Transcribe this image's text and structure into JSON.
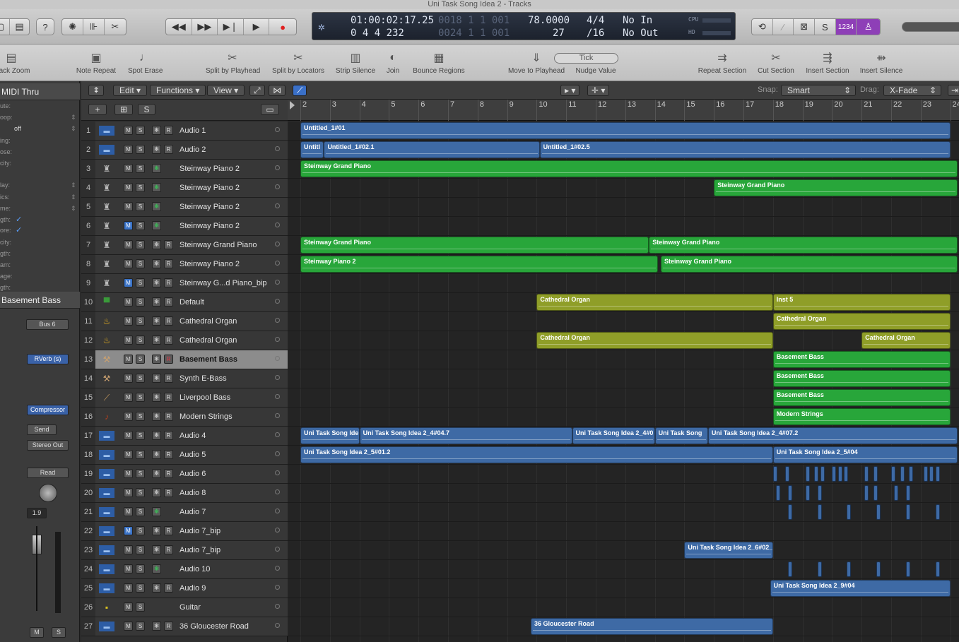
{
  "window": {
    "title": "Uni Task Song Idea 2 - Tracks"
  },
  "lcd": {
    "position_time": "01:00:02:17.25",
    "position_bars": "0  4  4  232",
    "time_dim": "0018  1  1  001",
    "bars_dim": "0024  1  1  001",
    "tempo": "78.0000",
    "sig_top": "4/4",
    "bar_num": "27",
    "division": "/16",
    "midi_in": "No In",
    "midi_out": "No Out",
    "cpu": "CPU",
    "hd": "HD"
  },
  "control": {
    "count_in": "1234"
  },
  "toolbar": {
    "items": [
      {
        "label": "Track Zoom",
        "icon": "track-zoom-icon"
      },
      {
        "label": "Note Repeat",
        "icon": "note-repeat-icon"
      },
      {
        "label": "Spot Erase",
        "icon": "spot-erase-icon"
      },
      {
        "label": "Split by Playhead",
        "icon": "scissors-icon"
      },
      {
        "label": "Split by Locators",
        "icon": "scissors-locators-icon"
      },
      {
        "label": "Strip Silence",
        "icon": "strip-silence-icon"
      },
      {
        "label": "Join",
        "icon": "glue-icon"
      },
      {
        "label": "Bounce Regions",
        "icon": "bounce-icon"
      },
      {
        "label": "Move to Playhead",
        "icon": "playhead-icon"
      },
      {
        "label": "Nudge Value",
        "icon": "nudge-icon"
      },
      {
        "label": "Repeat Section",
        "icon": "repeat-section-icon"
      },
      {
        "label": "Cut Section",
        "icon": "cut-section-icon"
      },
      {
        "label": "Insert Section",
        "icon": "insert-section-icon"
      },
      {
        "label": "Insert Silence",
        "icon": "insert-silence-icon"
      }
    ],
    "nudge_value": "Tick"
  },
  "inspector": {
    "header": "MIDI Thru",
    "rows": [
      "ute:",
      "oop:",
      "off",
      "ing:",
      "ose:",
      "city:",
      "lay:",
      "ics:",
      "me:",
      "gth:",
      "ore:",
      "city:",
      "gth:",
      "am:",
      "age:",
      "gth:"
    ],
    "region_header": "Basement Bass",
    "bus": "Bus 6",
    "plugin1": "RVerb (s)",
    "plugin2": "Compressor",
    "send": "Send",
    "output": "Stereo Out",
    "automation": "Read",
    "value": "1.9",
    "mute": "M",
    "solo": "S"
  },
  "trackbar": {
    "menus": [
      "Edit",
      "Functions",
      "View"
    ],
    "snap_label": "Snap:",
    "snap_value": "Smart",
    "drag_label": "Drag:",
    "drag_value": "X-Fade"
  },
  "ruler": {
    "bars": [
      "2",
      "3",
      "4",
      "5",
      "6",
      "7",
      "8",
      "9",
      "10",
      "11",
      "12",
      "13",
      "14",
      "15",
      "16",
      "17",
      "18",
      "19",
      "20",
      "21",
      "22",
      "23",
      "24"
    ]
  },
  "tracks": [
    {
      "num": "1",
      "name": "Audio 1",
      "type": "audio",
      "mute": false,
      "r": true
    },
    {
      "num": "2",
      "name": "Audio 2",
      "type": "audio",
      "mute": false,
      "r": true
    },
    {
      "num": "3",
      "name": "Steinway Piano 2",
      "type": "piano",
      "mute": false,
      "r": false
    },
    {
      "num": "4",
      "name": "Steinway Piano 2",
      "type": "piano",
      "mute": false,
      "r": false
    },
    {
      "num": "5",
      "name": "Steinway Piano 2",
      "type": "piano",
      "mute": false,
      "r": false
    },
    {
      "num": "6",
      "name": "Steinway Piano 2",
      "type": "piano",
      "mute": true,
      "r": false
    },
    {
      "num": "7",
      "name": "Steinway Grand Piano",
      "type": "piano",
      "mute": false,
      "r": true
    },
    {
      "num": "8",
      "name": "Steinway Piano 2",
      "type": "piano",
      "mute": false,
      "r": true
    },
    {
      "num": "9",
      "name": "Steinway G...d Piano_bip",
      "type": "piano",
      "mute": true,
      "r": true
    },
    {
      "num": "10",
      "name": "Default",
      "type": "synth",
      "mute": false,
      "r": true
    },
    {
      "num": "11",
      "name": "Cathedral Organ",
      "type": "organ",
      "mute": false,
      "r": true
    },
    {
      "num": "12",
      "name": "Cathedral Organ",
      "type": "organ",
      "mute": false,
      "r": true
    },
    {
      "num": "13",
      "name": "Basement Bass",
      "type": "bass",
      "mute": false,
      "r": true,
      "sel": true
    },
    {
      "num": "14",
      "name": "Synth E-Bass",
      "type": "bass",
      "mute": false,
      "r": true
    },
    {
      "num": "15",
      "name": "Liverpool Bass",
      "type": "guitar",
      "mute": false,
      "r": true
    },
    {
      "num": "16",
      "name": "Modern Strings",
      "type": "strings",
      "mute": false,
      "r": true
    },
    {
      "num": "17",
      "name": "Audio 4",
      "type": "audio",
      "mute": false,
      "r": true
    },
    {
      "num": "18",
      "name": "Audio 5",
      "type": "audio",
      "mute": false,
      "r": true
    },
    {
      "num": "19",
      "name": "Audio 6",
      "type": "audio",
      "mute": false,
      "r": true
    },
    {
      "num": "20",
      "name": "Audio 8",
      "type": "audio",
      "mute": false,
      "r": true
    },
    {
      "num": "21",
      "name": "Audio 7",
      "type": "audio",
      "mute": false,
      "r": false
    },
    {
      "num": "22",
      "name": "Audio 7_bip",
      "type": "audio",
      "mute": true,
      "r": true
    },
    {
      "num": "23",
      "name": "Audio 7_bip",
      "type": "audio",
      "mute": false,
      "r": true
    },
    {
      "num": "24",
      "name": "Audio 10",
      "type": "audio",
      "mute": false,
      "r": false
    },
    {
      "num": "25",
      "name": "Audio 9",
      "type": "audio",
      "mute": false,
      "r": true
    },
    {
      "num": "26",
      "name": "Guitar",
      "type": "amp",
      "mute": false,
      "r": false,
      "nofrz": true
    },
    {
      "num": "27",
      "name": "36 Gloucester Road",
      "type": "audio",
      "mute": false,
      "r": true
    }
  ],
  "regions": [
    {
      "lane": 0,
      "bar": 2,
      "end": 24,
      "name": "Untitled_1#01",
      "kind": "au"
    },
    {
      "lane": 1,
      "bar": 2,
      "end": 2.8,
      "name": "Untitl",
      "kind": "au"
    },
    {
      "lane": 1,
      "bar": 2.8,
      "end": 10.1,
      "name": "Untitled_1#02.1",
      "kind": "au"
    },
    {
      "lane": 1,
      "bar": 10.1,
      "end": 24,
      "name": "Untitled_1#02.5",
      "kind": "au"
    },
    {
      "lane": 2,
      "bar": 2,
      "end": 24.4,
      "name": "Steinway Grand Piano",
      "kind": "gr"
    },
    {
      "lane": 3,
      "bar": 16,
      "end": 24.4,
      "name": "Steinway Grand Piano",
      "kind": "gr"
    },
    {
      "lane": 6,
      "bar": 2,
      "end": 13.8,
      "name": "Steinway Grand Piano",
      "kind": "gr"
    },
    {
      "lane": 6,
      "bar": 13.8,
      "end": 24.4,
      "name": "Steinway Grand Piano",
      "kind": "gr"
    },
    {
      "lane": 7,
      "bar": 2,
      "end": 14.1,
      "name": "Steinway Piano 2",
      "kind": "gr"
    },
    {
      "lane": 7,
      "bar": 14.2,
      "end": 24.4,
      "name": "Steinway Grand Piano",
      "kind": "gr"
    },
    {
      "lane": 9,
      "bar": 10,
      "end": 18,
      "name": "Cathedral Organ",
      "kind": "ol"
    },
    {
      "lane": 9,
      "bar": 18,
      "end": 24,
      "name": "Inst 5",
      "kind": "ol"
    },
    {
      "lane": 10,
      "bar": 18,
      "end": 24,
      "name": "Cathedral Organ",
      "kind": "ol"
    },
    {
      "lane": 11,
      "bar": 10,
      "end": 18,
      "name": "Cathedral Organ",
      "kind": "ol"
    },
    {
      "lane": 11,
      "bar": 21,
      "end": 24,
      "name": "Cathedral Organ",
      "kind": "ol"
    },
    {
      "lane": 12,
      "bar": 18,
      "end": 24,
      "name": "Basement Bass",
      "kind": "gr"
    },
    {
      "lane": 13,
      "bar": 18,
      "end": 24,
      "name": "Basement Bass",
      "kind": "gr"
    },
    {
      "lane": 14,
      "bar": 18,
      "end": 24,
      "name": "Basement Bass",
      "kind": "gr"
    },
    {
      "lane": 15,
      "bar": 18,
      "end": 24,
      "name": "Modern Strings",
      "kind": "gr"
    },
    {
      "lane": 16,
      "bar": 2,
      "end": 4,
      "name": "Uni Task Song Ide",
      "kind": "au"
    },
    {
      "lane": 16,
      "bar": 4,
      "end": 11.2,
      "name": "Uni Task Song Idea 2_4#04.7",
      "kind": "au"
    },
    {
      "lane": 16,
      "bar": 11.2,
      "end": 14,
      "name": "Uni Task Song Idea 2_4#0",
      "kind": "au"
    },
    {
      "lane": 16,
      "bar": 14,
      "end": 15.8,
      "name": "Uni Task Song",
      "kind": "au"
    },
    {
      "lane": 16,
      "bar": 15.8,
      "end": 24.4,
      "name": "Uni Task Song Idea 2_4#07.2",
      "kind": "au"
    },
    {
      "lane": 17,
      "bar": 2,
      "end": 18,
      "name": "Uni Task Song Idea 2_5#01.2",
      "kind": "au"
    },
    {
      "lane": 17,
      "bar": 18,
      "end": 24.4,
      "name": "Uni Task Song Idea 2_5#04",
      "kind": "au"
    },
    {
      "lane": 22,
      "bar": 15,
      "end": 18,
      "name": "Uni Task Song Idea 2_6#02_",
      "kind": "au"
    },
    {
      "lane": 24,
      "bar": 17.9,
      "end": 24,
      "name": "Uni Task Song Idea 2_9#04",
      "kind": "au"
    },
    {
      "lane": 26,
      "bar": 9.8,
      "end": 18,
      "name": "36 Gloucester Road",
      "kind": "au"
    }
  ]
}
